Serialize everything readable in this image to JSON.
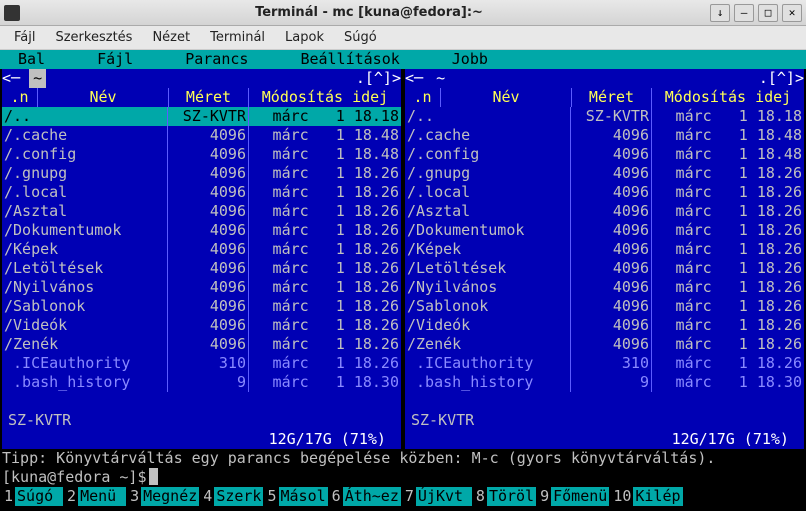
{
  "window": {
    "title": "Terminál - mc [kuna@fedora]:~",
    "buttons": {
      "pin": "↓",
      "min": "–",
      "max": "□",
      "close": "✕"
    }
  },
  "gtk_menu": {
    "items": [
      "Fájl",
      "Szerkesztés",
      "Nézet",
      "Terminál",
      "Lapok",
      "Súgó"
    ]
  },
  "mc_menu": {
    "items": [
      "Bal",
      "Fájl",
      "Parancs",
      "Beállítások",
      "Jobb"
    ]
  },
  "panel_top": {
    "left_pre": "<─ ",
    "path": "~",
    "right_suf": ".[^]>"
  },
  "columns": {
    "n": ".n",
    "name": "Név",
    "size": "Méret",
    "date": "Módosítás idej"
  },
  "left": {
    "rows": [
      {
        "name": "/..",
        "size": "SZ-KVTR",
        "date": " márc   1 18.18",
        "sel": true
      },
      {
        "name": "/.cache",
        "size": "4096",
        "date": " márc   1 18.48"
      },
      {
        "name": "/.config",
        "size": "4096",
        "date": " márc   1 18.48"
      },
      {
        "name": "/.gnupg",
        "size": "4096",
        "date": " márc   1 18.26"
      },
      {
        "name": "/.local",
        "size": "4096",
        "date": " márc   1 18.26"
      },
      {
        "name": "/Asztal",
        "size": "4096",
        "date": " márc   1 18.26"
      },
      {
        "name": "/Dokumentumok",
        "size": "4096",
        "date": " márc   1 18.26"
      },
      {
        "name": "/Képek",
        "size": "4096",
        "date": " márc   1 18.26"
      },
      {
        "name": "/Letöltések",
        "size": "4096",
        "date": " márc   1 18.26"
      },
      {
        "name": "/Nyilvános",
        "size": "4096",
        "date": " márc   1 18.26"
      },
      {
        "name": "/Sablonok",
        "size": "4096",
        "date": " márc   1 18.26"
      },
      {
        "name": "/Videók",
        "size": "4096",
        "date": " márc   1 18.26"
      },
      {
        "name": "/Zenék",
        "size": "4096",
        "date": " márc   1 18.26"
      },
      {
        "name": " .ICEauthority",
        "size": "310",
        "date": " márc   1 18.26",
        "hidden": true
      },
      {
        "name": " .bash_history",
        "size": "9",
        "date": " márc   1 18.30",
        "hidden": true
      }
    ],
    "footer1": "SZ-KVTR",
    "footer2": "12G/17G (71%) "
  },
  "right": {
    "rows": [
      {
        "name": "/..",
        "size": "SZ-KVTR",
        "date": " márc   1 18.18"
      },
      {
        "name": "/.cache",
        "size": "4096",
        "date": " márc   1 18.48"
      },
      {
        "name": "/.config",
        "size": "4096",
        "date": " márc   1 18.48"
      },
      {
        "name": "/.gnupg",
        "size": "4096",
        "date": " márc   1 18.26"
      },
      {
        "name": "/.local",
        "size": "4096",
        "date": " márc   1 18.26"
      },
      {
        "name": "/Asztal",
        "size": "4096",
        "date": " márc   1 18.26"
      },
      {
        "name": "/Dokumentumok",
        "size": "4096",
        "date": " márc   1 18.26"
      },
      {
        "name": "/Képek",
        "size": "4096",
        "date": " márc   1 18.26"
      },
      {
        "name": "/Letöltések",
        "size": "4096",
        "date": " márc   1 18.26"
      },
      {
        "name": "/Nyilvános",
        "size": "4096",
        "date": " márc   1 18.26"
      },
      {
        "name": "/Sablonok",
        "size": "4096",
        "date": " márc   1 18.26"
      },
      {
        "name": "/Videók",
        "size": "4096",
        "date": " márc   1 18.26"
      },
      {
        "name": "/Zenék",
        "size": "4096",
        "date": " márc   1 18.26"
      },
      {
        "name": " .ICEauthority",
        "size": "310",
        "date": " márc   1 18.26",
        "hidden": true
      },
      {
        "name": " .bash_history",
        "size": "9",
        "date": " márc   1 18.30",
        "hidden": true
      }
    ],
    "footer1": "SZ-KVTR",
    "footer2": "12G/17G (71%) "
  },
  "tip": "Tipp: Könyvtárváltás egy parancs begépelése közben: M-c (gyors könyvtárváltás).",
  "prompt": "[kuna@fedora ~]$ ",
  "fkeys": [
    {
      "n": "1",
      "l": "Súgó"
    },
    {
      "n": "2",
      "l": "Menü"
    },
    {
      "n": "3",
      "l": "Megnéz"
    },
    {
      "n": "4",
      "l": "Szerk"
    },
    {
      "n": "5",
      "l": "Másol"
    },
    {
      "n": "6",
      "l": "Áth~ez"
    },
    {
      "n": "7",
      "l": "ÚjKvt"
    },
    {
      "n": "8",
      "l": "Töröl"
    },
    {
      "n": "9",
      "l": "Főmenü"
    },
    {
      "n": "10",
      "l": "Kilép"
    }
  ]
}
